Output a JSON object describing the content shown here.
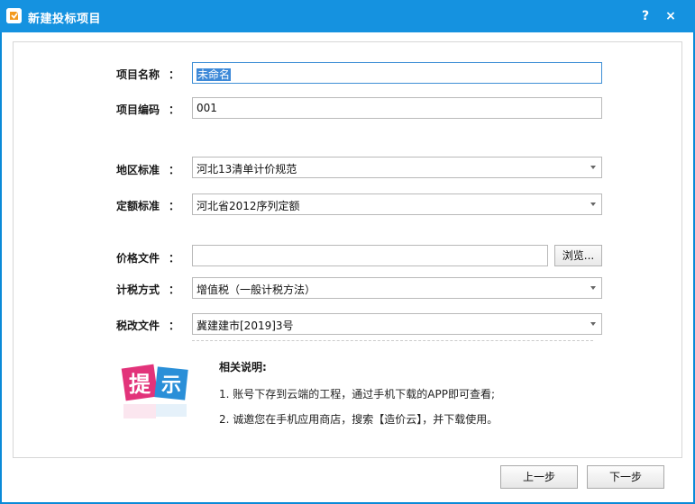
{
  "window": {
    "title": "新建投标项目",
    "help_label": "?",
    "close_label": "×"
  },
  "form": {
    "project_name": {
      "label": "项目名称",
      "colon": "：",
      "value": "未命名"
    },
    "project_code": {
      "label": "项目编码",
      "colon": "：",
      "value": "001"
    },
    "region_standard": {
      "label": "地区标准",
      "colon": "：",
      "value": "河北13清单计价规范"
    },
    "quota_standard": {
      "label": "定额标准",
      "colon": "：",
      "value": "河北省2012序列定额"
    },
    "price_file": {
      "label": "价格文件",
      "colon": "：",
      "value": "",
      "browse_label": "浏览..."
    },
    "tax_method": {
      "label": "计税方式",
      "colon": "：",
      "value": "增值税（一般计税方法）"
    },
    "tax_reform_file": {
      "label": "税改文件",
      "colon": "：",
      "value": "冀建建市[2019]3号"
    }
  },
  "tip": {
    "logo_chars": [
      "提",
      "示"
    ],
    "title": "相关说明:",
    "notes": [
      "1. 账号下存到云端的工程，通过手机下载的APP即可查看;",
      "2. 诚邀您在手机应用商店，搜索【造价云】，并下载使用。"
    ]
  },
  "footer": {
    "prev_label": "上一步",
    "next_label": "下一步"
  },
  "colors": {
    "titlebar": "#1592e0",
    "logo_pink": "#e2337a",
    "logo_blue": "#2a8fd8"
  }
}
